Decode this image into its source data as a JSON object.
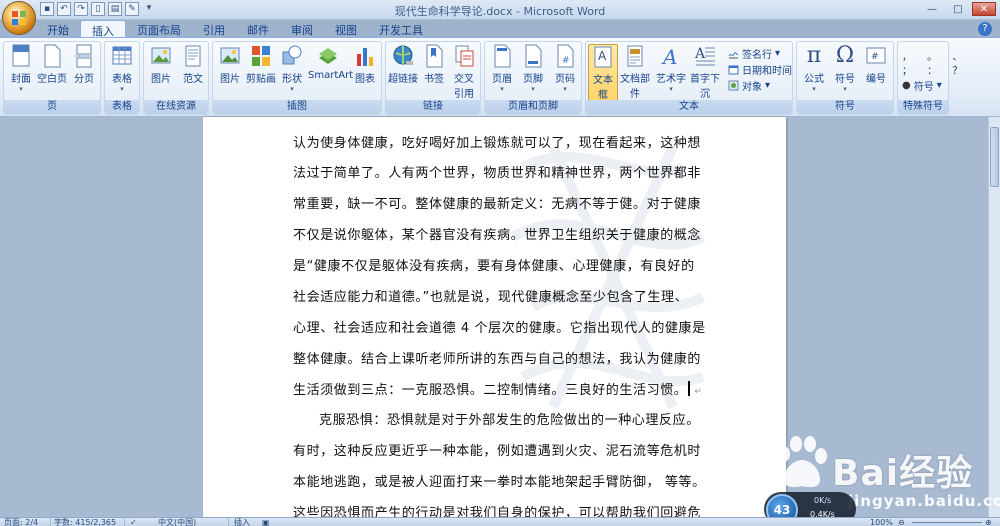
{
  "window": {
    "title": "现代生命科学导论.docx - Microsoft Word",
    "controls": [
      "—",
      "□",
      "✕"
    ]
  },
  "quick_access": [
    "save",
    "undo",
    "redo",
    "new",
    "print",
    "customize"
  ],
  "tabs": [
    {
      "label": "开始",
      "active": false
    },
    {
      "label": "插入",
      "active": true
    },
    {
      "label": "页面布局",
      "active": false
    },
    {
      "label": "引用",
      "active": false
    },
    {
      "label": "邮件",
      "active": false
    },
    {
      "label": "审阅",
      "active": false
    },
    {
      "label": "视图",
      "active": false
    },
    {
      "label": "开发工具",
      "active": false
    }
  ],
  "ribbon": {
    "groups": {
      "pages": "页",
      "tables": "表格",
      "online": "在线资源",
      "illustrations": "插图",
      "links": "链接",
      "header_footer": "页眉和页脚",
      "text": "文本",
      "symbols": "符号",
      "special_symbols": "特殊符号"
    },
    "buttons": {
      "cover": "封面",
      "blank_page": "空白页",
      "page_break": "分页",
      "table": "表格",
      "picture_online": "图片",
      "template": "范文",
      "picture": "图片",
      "clipart": "剪贴画",
      "shapes": "形状",
      "smartart": "SmartArt",
      "chart": "图表",
      "hyperlink": "超链接",
      "bookmark": "书签",
      "cross_ref_1": "交叉",
      "cross_ref_2": "引用",
      "header": "页眉",
      "footer": "页脚",
      "page_number": "页码",
      "text_box": "文本框",
      "quick_parts": "文档部件",
      "wordart": "艺术字",
      "drop_cap": "首字下沉",
      "signature": "签名行",
      "datetime": "日期和时间",
      "object": "对象",
      "equation": "公式",
      "symbol": "符号",
      "numbering": "编号",
      "special_symbol": "符号"
    }
  },
  "document": {
    "lines": [
      "认为使身体健康，吃好喝好加上锻炼就可以了，现在看起来，这种想",
      "法过于简单了。人有两个世界，物质世界和精神世界，两个世界都非",
      "常重要，缺一不可。整体健康的最新定义：无病不等于健。对于健康",
      "不仅是说你躯体，某个器官没有疾病。世界卫生组织关于健康的概念",
      "是“健康不仅是躯体没有疾病，要有身体健康、心理健康，有良好的",
      "社会适应能力和道德。”也就是说，现代健康概念至少包含了生理、",
      "心理、社会适应和社会道德 4 个层次的健康。它指出现代人的健康是",
      "整体健康。结合上课听老师所讲的东西与自己的想法，我认为健康的",
      "生活须做到三点：一克服恐惧。二控制情绪。三良好的生活习惯。",
      "克服恐惧：恐惧就是对于外部发生的危险做出的一种心理反应。",
      "有时，这种反应更近乎一种本能，例如遭遇到火灾、泥石流等危机时",
      "本能地逃跑，或是被人迎面打来一拳时本能地架起手臂防御， 等等。",
      "这些因恐惧而产生的行动是对我们自身的保护，可以帮助我们回避危"
    ],
    "paragraph_mark": "↵"
  },
  "statusbar": {
    "page": "页面: 2/4",
    "words": "字数: 415/2,365",
    "language": "中文(中国)",
    "insert_mode": "插入",
    "zoom": "100%"
  },
  "speed_widget": {
    "percent": "43",
    "upload": "0K/s",
    "download": "0.4K/s"
  },
  "watermark": {
    "brand": "Bai经验",
    "url": "jingyan.baidu.com"
  }
}
